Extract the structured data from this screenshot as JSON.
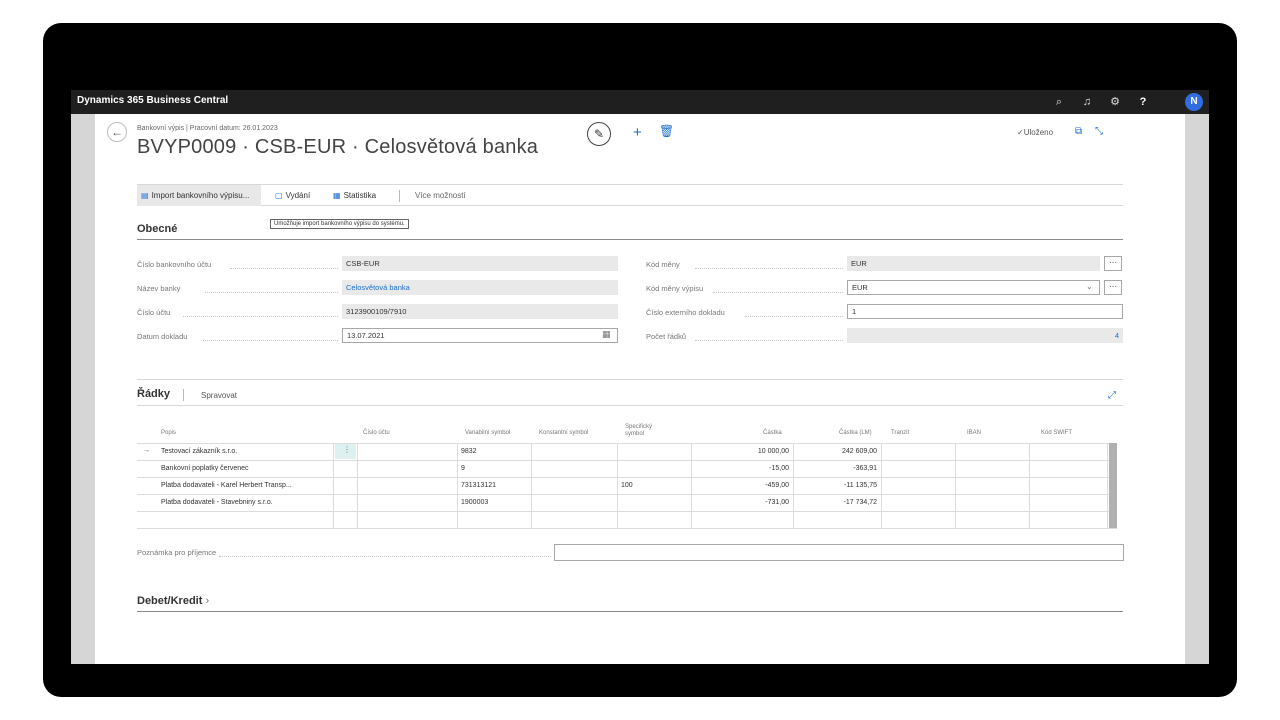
{
  "app": {
    "title": "Dynamics 365 Business Central",
    "avatar": "N"
  },
  "topbar_icons": [
    "search-icon",
    "bell-icon",
    "gear-icon",
    "help-icon"
  ],
  "help_glyph": "?",
  "header": {
    "breadcrumb": "Bankovní výpis | Pracovní datum: 26.01.2023",
    "title": "BVYP0009 · CSB-EUR · Celosvětová banka",
    "saved": "Uloženo"
  },
  "actions": {
    "import": "Import bankovního výpisu...",
    "vydani": "Vydání",
    "statistika": "Statistika",
    "more": "Více možností",
    "tooltip": "Umožňuje import bankovního výpisu do systému."
  },
  "general": {
    "section_title": "Obecné",
    "fields": {
      "bank_account_no_label": "Číslo bankovního účtu",
      "bank_account_no": "CSB-EUR",
      "bank_name_label": "Název banky",
      "bank_name": "Celosvětová banka",
      "account_no_label": "Číslo účtu",
      "account_no": "3123900109/7910",
      "document_date_label": "Datum dokladu",
      "document_date": "13.07.2021",
      "currency_code_label": "Kód měny",
      "currency_code": "EUR",
      "statement_currency_label": "Kód měny výpisu",
      "statement_currency": "EUR",
      "external_doc_label": "Číslo externího dokladu",
      "external_doc": "1",
      "line_count_label": "Počet řádků",
      "line_count": "4"
    }
  },
  "lines": {
    "section_title": "Řádky",
    "manage_tab": "Spravovat",
    "columns": [
      "Popis",
      "Číslo účtu",
      "Variabilní symbol",
      "Konstantní symbol",
      "Specifický symbol",
      "Částka",
      "Částka (LM)",
      "Tranzit",
      "IBAN",
      "Kód SWIFT"
    ],
    "rows": [
      {
        "popis": "Testovací zákazník s.r.o.",
        "ucet": "",
        "vs": "9832",
        "ks": "",
        "ss": "",
        "castka": "10 000,00",
        "castka_lm": "242 609,00"
      },
      {
        "popis": "Bankovní poplatky červenec",
        "ucet": "",
        "vs": "9",
        "ks": "",
        "ss": "",
        "castka": "-15,00",
        "castka_lm": "-363,91"
      },
      {
        "popis": "Platba dodavateli - Karel Herbert Transp...",
        "ucet": "",
        "vs": "731313121",
        "ks": "",
        "ss": "100",
        "castka": "-459,00",
        "castka_lm": "-11 135,75"
      },
      {
        "popis": "Platba dodavateli - Stavebniny s.r.o.",
        "ucet": "",
        "vs": "1900003",
        "ks": "",
        "ss": "",
        "castka": "-731,00",
        "castka_lm": "-17 734,72"
      }
    ]
  },
  "note": {
    "label": "Poznámka pro příjemce",
    "value": ""
  },
  "debit_credit": {
    "section_title": "Debet/Kredit"
  }
}
